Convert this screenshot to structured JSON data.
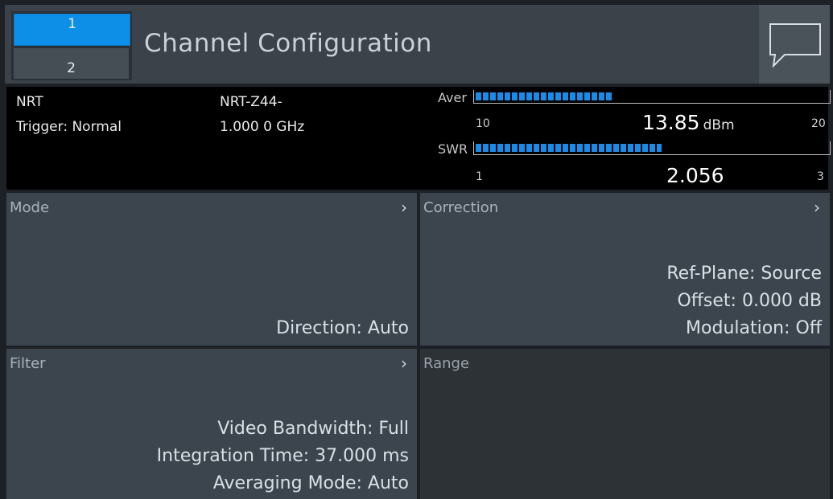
{
  "header": {
    "channel_tabs": [
      "1",
      "2"
    ],
    "active_channel": "1",
    "title": "Channel Configuration",
    "message_icon": "speech-bubble-icon"
  },
  "status": {
    "sensor": "NRT",
    "trigger": "Trigger: Normal",
    "probe": "NRT-Z44-",
    "frequency": "1.000 0 GHz",
    "aver": {
      "label": "Aver",
      "scale_min": "10",
      "scale_max": "20",
      "value": "13.85",
      "unit": "dBm",
      "fill_fraction": 0.385
    },
    "swr": {
      "label": "SWR",
      "scale_min": "1",
      "scale_max": "3",
      "value": "2.056",
      "fill_fraction": 0.528
    }
  },
  "panels": {
    "mode": {
      "title": "Mode",
      "lines": [
        "Direction: Auto"
      ]
    },
    "correction": {
      "title": "Correction",
      "lines": [
        "Ref-Plane: Source",
        "Offset: 0.000 dB",
        "Modulation: Off"
      ]
    },
    "filter": {
      "title": "Filter",
      "lines": [
        "Video Bandwidth: Full",
        "Integration Time: 37.000 ms",
        "Averaging Mode: Auto"
      ]
    },
    "range": {
      "title": "Range"
    }
  },
  "colors": {
    "accent": "#0d8fe8",
    "bar_fill": "#1a8be6",
    "panel": "#3c454d",
    "panel_disabled": "#2d3237"
  }
}
